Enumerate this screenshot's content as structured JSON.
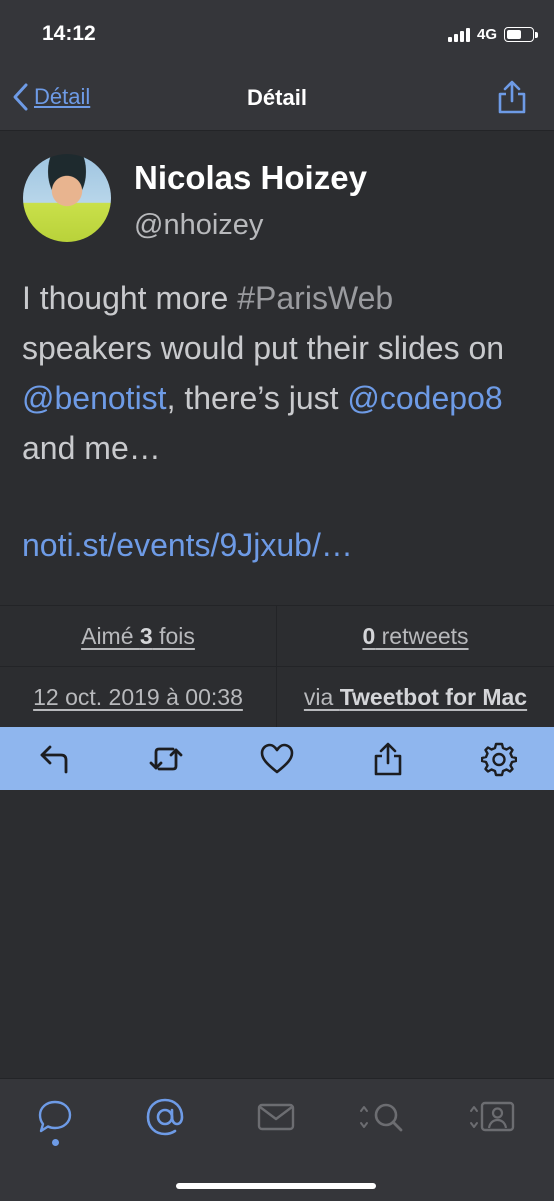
{
  "status": {
    "time": "14:12",
    "network": "4G"
  },
  "nav": {
    "back_label": "Détail",
    "title": "Détail"
  },
  "tweet": {
    "name": "Nicolas Hoizey",
    "handle": "@nhoizey",
    "text_1": "I thought more ",
    "hashtag": "#ParisWeb",
    "text_2": " speakers would put their slides on ",
    "mention_1": "@benotist",
    "text_3": ", there’s just ",
    "mention_2": "@codepo8",
    "text_4": " and me…",
    "link": "noti.st/events/9Jjxub/…"
  },
  "stats": {
    "likes_prefix": "Aimé ",
    "likes_count": "3",
    "likes_suffix": " fois",
    "retweets_count": "0",
    "retweets_label": " retweets",
    "date": "12 oct. 2019 à 00:38",
    "via_prefix": "via ",
    "via_client": "Tweetbot for Mac"
  },
  "icons": {
    "actions": [
      "reply-icon",
      "retweet-icon",
      "like-icon",
      "share-icon",
      "settings-icon"
    ],
    "tabs": [
      "timeline-icon",
      "mentions-icon",
      "messages-icon",
      "search-icon",
      "profile-icon"
    ]
  },
  "colors": {
    "accent": "#6e9be6",
    "action_bar": "#8fb6ee",
    "background": "#2c2d30"
  }
}
